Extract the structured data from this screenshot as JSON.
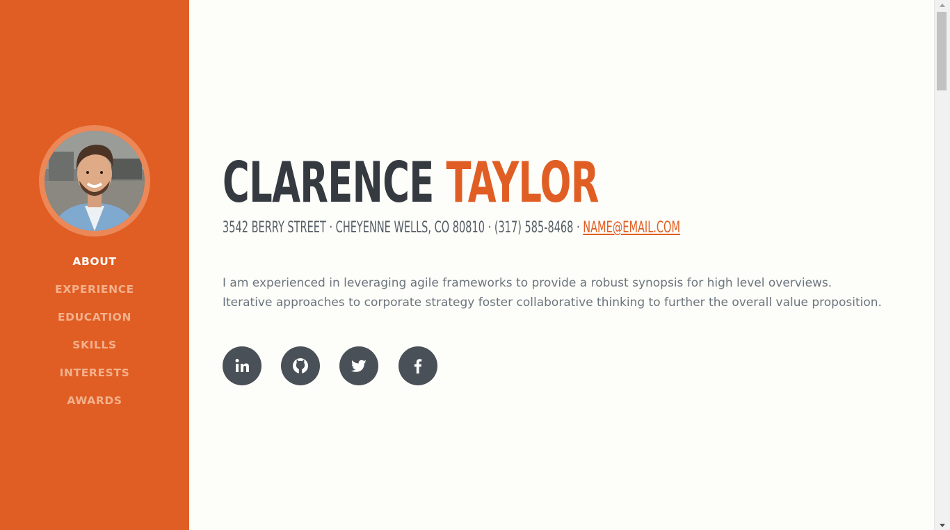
{
  "profile": {
    "first_name": "CLARENCE",
    "last_name": "TAYLOR",
    "address": "3542 BERRY STREET · CHEYENNE WELLS, CO 80810 · (317) 585-8468 · ",
    "email": "NAME@EMAIL.COM",
    "bio": "I am experienced in leveraging agile frameworks to provide a robust synopsis for high level overviews. Iterative approaches to corporate strategy foster collaborative thinking to further the overall value proposition."
  },
  "nav": {
    "items": [
      {
        "label": "ABOUT",
        "active": true
      },
      {
        "label": "EXPERIENCE",
        "active": false
      },
      {
        "label": "EDUCATION",
        "active": false
      },
      {
        "label": "SKILLS",
        "active": false
      },
      {
        "label": "INTERESTS",
        "active": false
      },
      {
        "label": "AWARDS",
        "active": false
      }
    ]
  },
  "social": [
    {
      "icon": "linkedin-icon"
    },
    {
      "icon": "github-icon"
    },
    {
      "icon": "twitter-icon"
    },
    {
      "icon": "facebook-icon"
    }
  ],
  "colors": {
    "accent": "#e05e24",
    "dark": "#343a40",
    "social_bg": "#495057",
    "background": "#fdfdf9"
  }
}
